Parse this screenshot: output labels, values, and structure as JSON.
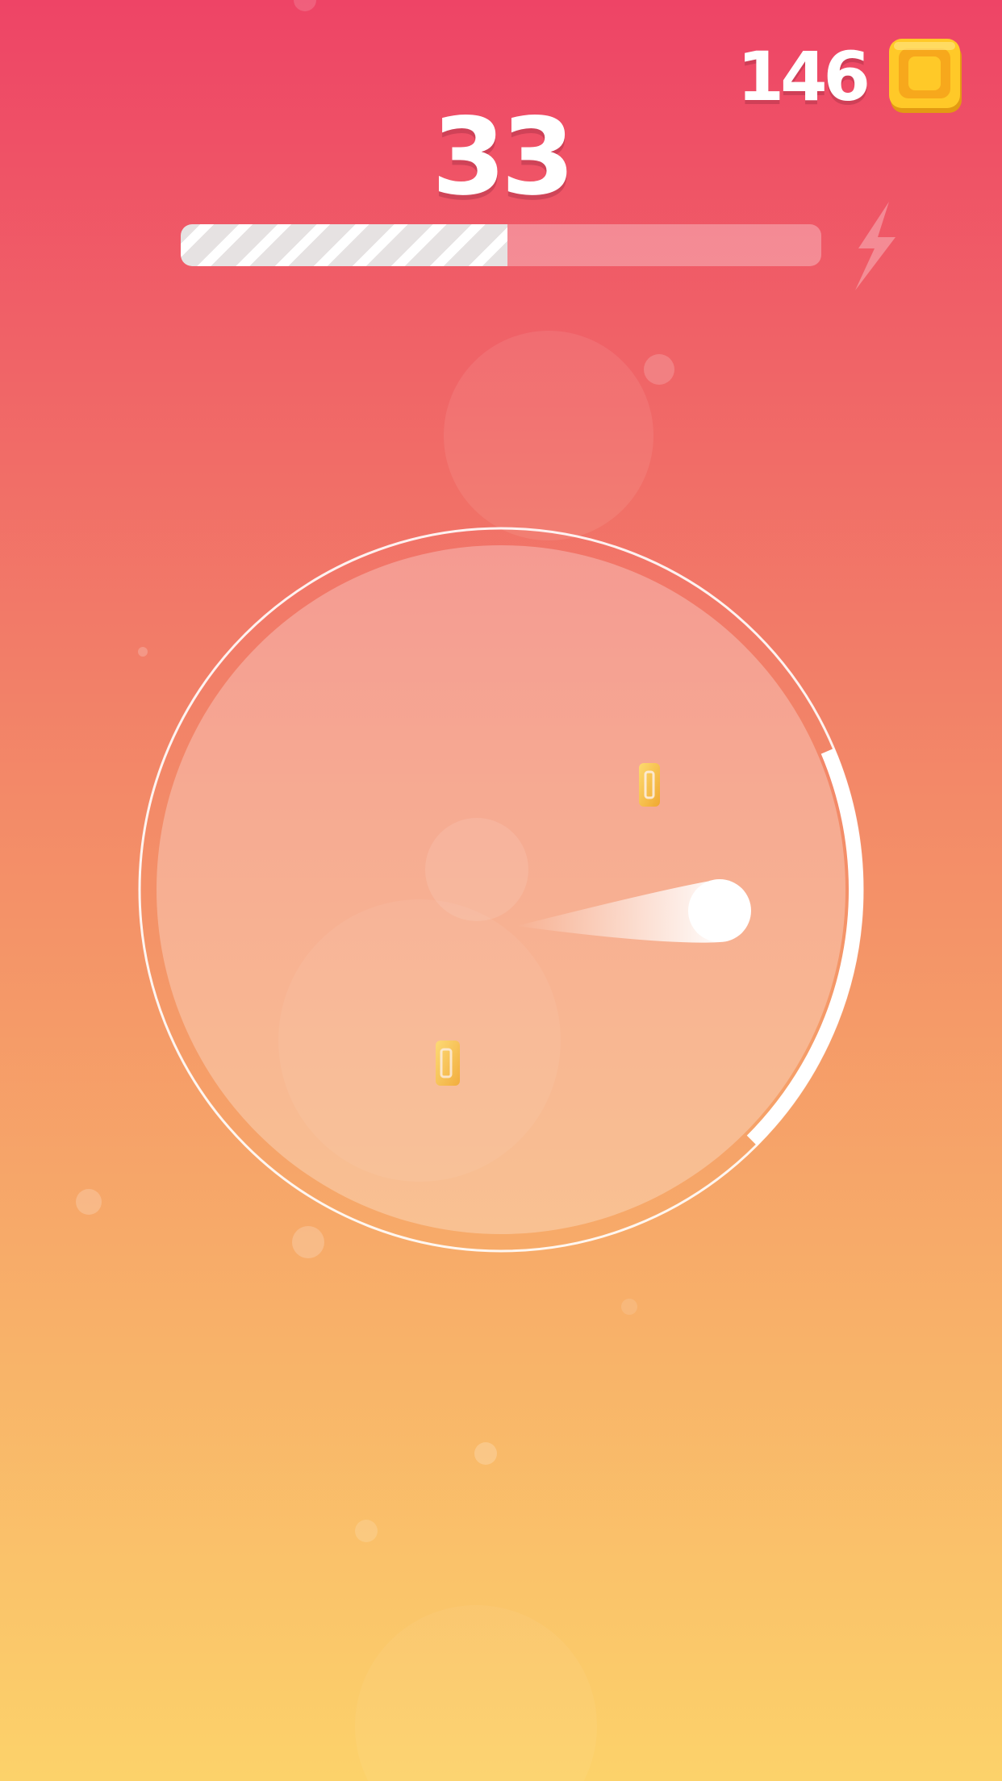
{
  "hud": {
    "score": "33",
    "coins": "146",
    "coin_icon": "gold-coin-icon",
    "boost_icon": "lightning-bolt-icon",
    "boost_progress": 0.51
  },
  "colors": {
    "background_top": "#EE4466",
    "background_bottom": "#FCD26A",
    "ball": "#FFFFFF",
    "arc": "#FFFFFF",
    "coin": "#F7C43A"
  },
  "game": {
    "coins_on_field": 2,
    "ball": "white-ball",
    "paddle": "white-arc-paddle"
  }
}
